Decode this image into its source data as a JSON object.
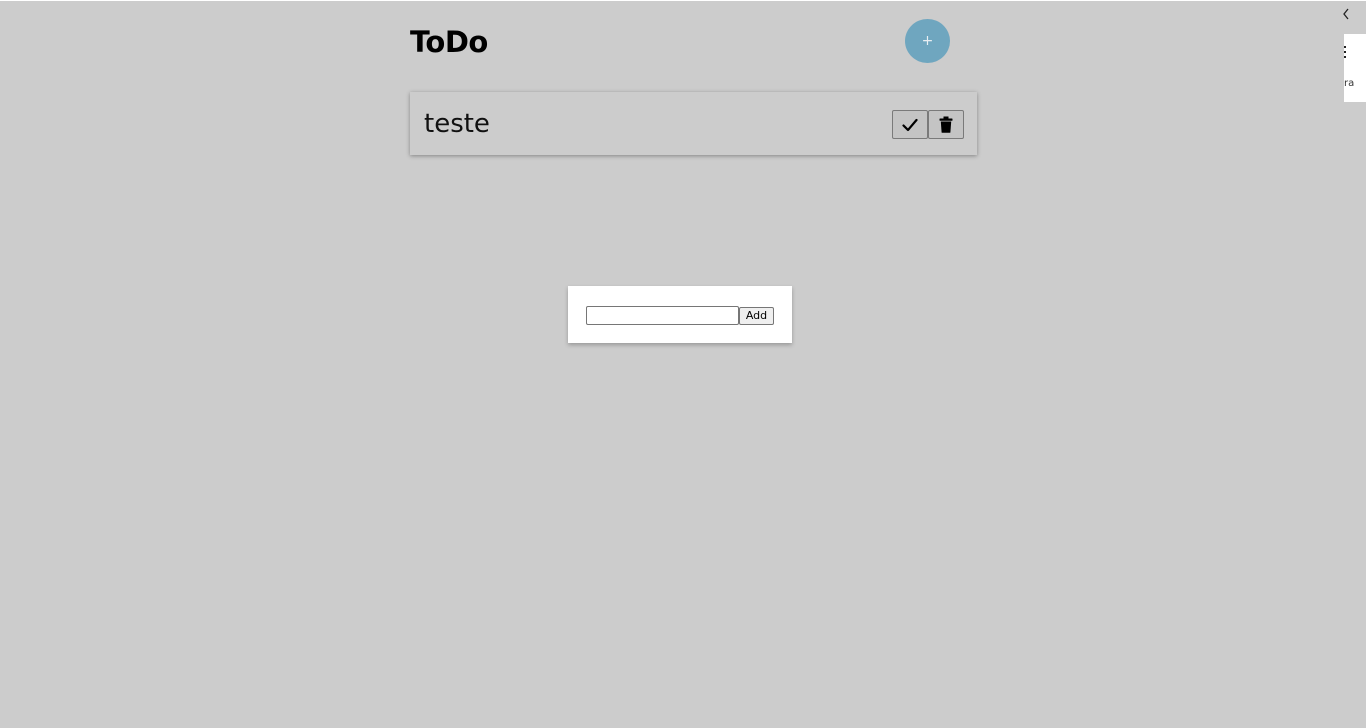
{
  "header": {
    "title": "ToDo",
    "add_fab_label": "+"
  },
  "todos": [
    {
      "text": "teste",
      "complete_icon": "check-icon",
      "delete_icon": "trash-icon"
    }
  ],
  "modal": {
    "input_value": "",
    "add_label": "Add"
  },
  "side_panel": {
    "back_icon": "chevron-left-icon",
    "menu_icon": "kebab-menu-icon",
    "text": "ra"
  },
  "colors": {
    "background": "#cccccc",
    "fab": "#6fa6bf",
    "modal": "#ffffff"
  }
}
